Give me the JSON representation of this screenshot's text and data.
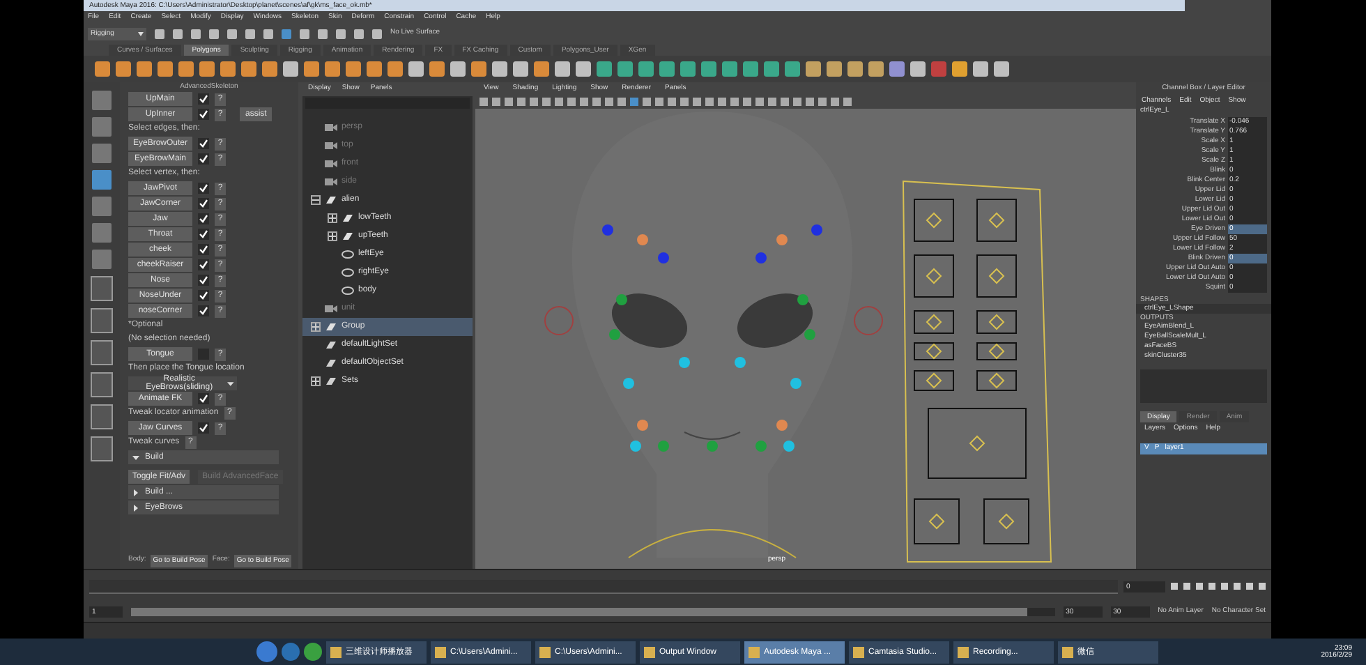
{
  "window": {
    "title": "Autodesk Maya 2016: C:\\Users\\Administrator\\Desktop\\planet\\scenes\\af\\gk\\ms_face_ok.mb*"
  },
  "menu_bar": [
    "File",
    "Edit",
    "Create",
    "Select",
    "Modify",
    "Display",
    "Windows",
    "Skeleton",
    "Skin",
    "Deform",
    "Constrain",
    "Control",
    "Cache",
    "Help"
  ],
  "status_line": {
    "mode": "Rigging",
    "live_surface": "No Live Surface"
  },
  "shelf_tabs": [
    {
      "label": "Curves / Surfaces",
      "selected": false
    },
    {
      "label": "Polygons",
      "selected": true
    },
    {
      "label": "Sculpting",
      "selected": false
    },
    {
      "label": "Rigging",
      "selected": false
    },
    {
      "label": "Animation",
      "selected": false
    },
    {
      "label": "Rendering",
      "selected": false
    },
    {
      "label": "FX",
      "selected": false
    },
    {
      "label": "FX Caching",
      "selected": false
    },
    {
      "label": "Custom",
      "selected": false
    },
    {
      "label": "Polygons_User",
      "selected": false
    },
    {
      "label": "XGen",
      "selected": false
    }
  ],
  "advanced_skeleton": {
    "title": "AdvancedSkeleton",
    "items": [
      {
        "kind": "button",
        "label": "UpMain",
        "checked": true,
        "help": "?"
      },
      {
        "kind": "button",
        "label": "UpInner",
        "checked": true,
        "help": "?",
        "extra": "assist"
      },
      {
        "kind": "note",
        "text": "Select edges, then:"
      },
      {
        "kind": "button",
        "label": "EyeBrowOuter",
        "checked": true,
        "help": "?"
      },
      {
        "kind": "button",
        "label": "EyeBrowMain",
        "checked": true,
        "help": "?"
      },
      {
        "kind": "note",
        "text": "Select vertex, then:"
      },
      {
        "kind": "button",
        "label": "JawPivot",
        "checked": true,
        "help": "?"
      },
      {
        "kind": "button",
        "label": "JawCorner",
        "checked": true,
        "help": "?"
      },
      {
        "kind": "button",
        "label": "Jaw",
        "checked": true,
        "help": "?"
      },
      {
        "kind": "button",
        "label": "Throat",
        "checked": true,
        "help": "?"
      },
      {
        "kind": "button",
        "label": "cheek",
        "checked": true,
        "help": "?"
      },
      {
        "kind": "button",
        "label": "cheekRaiser",
        "checked": true,
        "help": "?"
      },
      {
        "kind": "button",
        "label": "Nose",
        "checked": true,
        "help": "?"
      },
      {
        "kind": "button",
        "label": "NoseUnder",
        "checked": true,
        "help": "?"
      },
      {
        "kind": "button",
        "label": "noseCorner",
        "checked": true,
        "help": "?"
      },
      {
        "kind": "note",
        "text": "*Optional"
      },
      {
        "kind": "note",
        "text": "(No selection needed)"
      },
      {
        "kind": "button",
        "label": "Tongue",
        "checked": false,
        "help": "?"
      },
      {
        "kind": "note",
        "text": "Then place the Tongue location"
      },
      {
        "kind": "dropdown",
        "label": "Realistic EyeBrows(sliding)"
      },
      {
        "kind": "button",
        "label": "Animate FK",
        "checked": true,
        "help": "?"
      },
      {
        "kind": "note",
        "text": "Tweak locator animation",
        "help": "?"
      },
      {
        "kind": "button",
        "label": "Jaw Curves",
        "checked": true,
        "help": "?"
      },
      {
        "kind": "note",
        "text": "Tweak curves",
        "help": "?"
      },
      {
        "kind": "section",
        "label": "Build",
        "expanded": true
      },
      {
        "kind": "pair",
        "buttons": [
          {
            "label": "Toggle Fit/Adv",
            "disabled": false
          },
          {
            "label": "Build AdvancedFace",
            "disabled": true
          }
        ]
      },
      {
        "kind": "section",
        "label": "Build ...",
        "expanded": false
      },
      {
        "kind": "section",
        "label": "EyeBrows",
        "expanded": false
      }
    ],
    "footer": [
      {
        "kind": "label",
        "text": "Body:"
      },
      {
        "kind": "button",
        "text": "Go to Build Pose"
      },
      {
        "kind": "label",
        "text": "Face:"
      },
      {
        "kind": "button",
        "text": "Go to Build Pose"
      }
    ]
  },
  "outliner": {
    "menu": [
      "Display",
      "Show",
      "Panels"
    ],
    "items": [
      {
        "label": "persp",
        "kind": "camera",
        "dimmed": true,
        "selected": false
      },
      {
        "label": "top",
        "kind": "camera",
        "dimmed": true,
        "selected": false
      },
      {
        "label": "front",
        "kind": "camera",
        "dimmed": true,
        "selected": false
      },
      {
        "label": "side",
        "kind": "camera",
        "dimmed": true,
        "selected": false
      },
      {
        "label": "alien",
        "kind": "transform",
        "dimmed": false,
        "selected": false,
        "expanded": true,
        "children": [
          {
            "label": "lowTeeth",
            "kind": "transform",
            "dimmed": false,
            "selected": false,
            "expanded": false
          },
          {
            "label": "upTeeth",
            "kind": "transform",
            "dimmed": false,
            "selected": false,
            "expanded": false
          },
          {
            "label": "leftEye",
            "kind": "mesh",
            "dimmed": false,
            "selected": false
          },
          {
            "label": "rightEye",
            "kind": "mesh",
            "dimmed": false,
            "selected": false
          },
          {
            "label": "body",
            "kind": "mesh",
            "dimmed": false,
            "selected": false
          }
        ]
      },
      {
        "label": "unit",
        "kind": "camera",
        "dimmed": true,
        "selected": false
      },
      {
        "label": "Group",
        "kind": "transform",
        "dimmed": false,
        "selected": true,
        "expanded": false
      },
      {
        "label": "defaultLightSet",
        "kind": "set",
        "dimmed": false,
        "selected": false
      },
      {
        "label": "defaultObjectSet",
        "kind": "set",
        "dimmed": false,
        "selected": false
      },
      {
        "label": "Sets",
        "kind": "set",
        "dimmed": false,
        "selected": false,
        "expanded": false
      }
    ]
  },
  "viewport": {
    "menu": [
      "View",
      "Shading",
      "Lighting",
      "Show",
      "Renderer",
      "Panels"
    ],
    "camera_label": "persp"
  },
  "channel_box": {
    "title": "Channel Box / Layer Editor",
    "menu": [
      "Channels",
      "Edit",
      "Object",
      "Show"
    ],
    "node": "ctrlEye_L",
    "attributes": [
      {
        "name": "Translate X",
        "value": "-0.046",
        "selected": false
      },
      {
        "name": "Translate Y",
        "value": "0.766",
        "selected": false
      },
      {
        "name": "Scale X",
        "value": "1",
        "selected": false
      },
      {
        "name": "Scale Y",
        "value": "1",
        "selected": false
      },
      {
        "name": "Scale Z",
        "value": "1",
        "selected": false
      },
      {
        "name": "Blink",
        "value": "0",
        "selected": false
      },
      {
        "name": "Blink Center",
        "value": "0.2",
        "selected": false
      },
      {
        "name": "Upper Lid",
        "value": "0",
        "selected": false
      },
      {
        "name": "Lower Lid",
        "value": "0",
        "selected": false
      },
      {
        "name": "Upper Lid Out",
        "value": "0",
        "selected": false
      },
      {
        "name": "Lower Lid Out",
        "value": "0",
        "selected": false
      },
      {
        "name": "Eye Driven",
        "value": "0",
        "selected": true
      },
      {
        "name": "Upper Lid Follow",
        "value": "50",
        "selected": false
      },
      {
        "name": "Lower Lid Follow",
        "value": "2",
        "selected": false
      },
      {
        "name": "Blink Driven",
        "value": "0",
        "selected": true
      },
      {
        "name": "Upper Lid Out Auto",
        "value": "0",
        "selected": false
      },
      {
        "name": "Lower Lid Out Auto",
        "value": "0",
        "selected": false
      },
      {
        "name": "Squint",
        "value": "0",
        "selected": false
      }
    ],
    "shapes_heading": "SHAPES",
    "shapes": [
      "ctrlEye_LShape"
    ],
    "outputs_heading": "OUTPUTS",
    "outputs": [
      "EyeAimBlend_L",
      "EyeBallScaleMult_L",
      "asFaceBS",
      "skinCluster35"
    ],
    "layer_tabs": [
      {
        "label": "Display",
        "selected": true
      },
      {
        "label": "Render",
        "selected": false
      },
      {
        "label": "Anim",
        "selected": false
      }
    ],
    "layer_menu": [
      "Layers",
      "Options",
      "Help"
    ],
    "layers": [
      {
        "visible": "V",
        "playback": "P",
        "name": "layer1",
        "selected": true
      }
    ]
  },
  "range_slider": {
    "level": 0.97,
    "start": "1",
    "end": "30",
    "max_end": "30",
    "anim_layer": "No Anim Layer",
    "character_set": "No Character Set",
    "current_frame": "0"
  },
  "taskbar": {
    "items": [
      {
        "label": "三维设计师播放器",
        "active": false
      },
      {
        "label": "C:\\Users\\Admini...",
        "active": false
      },
      {
        "label": "C:\\Users\\Admini...",
        "active": false
      },
      {
        "label": "Output Window",
        "active": false
      },
      {
        "label": "Autodesk Maya ...",
        "active": true
      },
      {
        "label": "Camtasia Studio...",
        "active": false
      },
      {
        "label": "Recording...",
        "active": false
      },
      {
        "label": "微信",
        "active": false
      }
    ],
    "time": "23:09",
    "date": "2016/2/29"
  }
}
